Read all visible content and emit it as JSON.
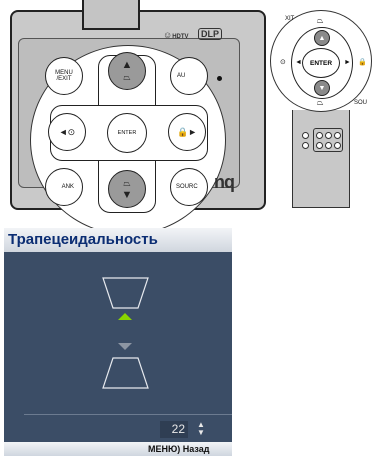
{
  "projector": {
    "menu_label": "MENU\n/EXIT",
    "auto_label": "AU",
    "enter_label": "ENTER",
    "blank_label": "ANK",
    "source_label": "SOURC",
    "left_icon": "◄⊙",
    "right_icon": "🔒►",
    "brand": "nq"
  },
  "remote": {
    "exit_label": "XIT",
    "enter_label": "ENTER",
    "source_label": "SOU"
  },
  "osd": {
    "title": "Трапецеидальность",
    "value": "22",
    "footer_menu": "МЕНЮ",
    "footer_back": "Назад"
  },
  "colors": {
    "osd_bg": "#3b4d66",
    "title_text": "#0b2d73",
    "arrow_active": "#8ad400",
    "arrow_inactive": "#8d96a3"
  }
}
